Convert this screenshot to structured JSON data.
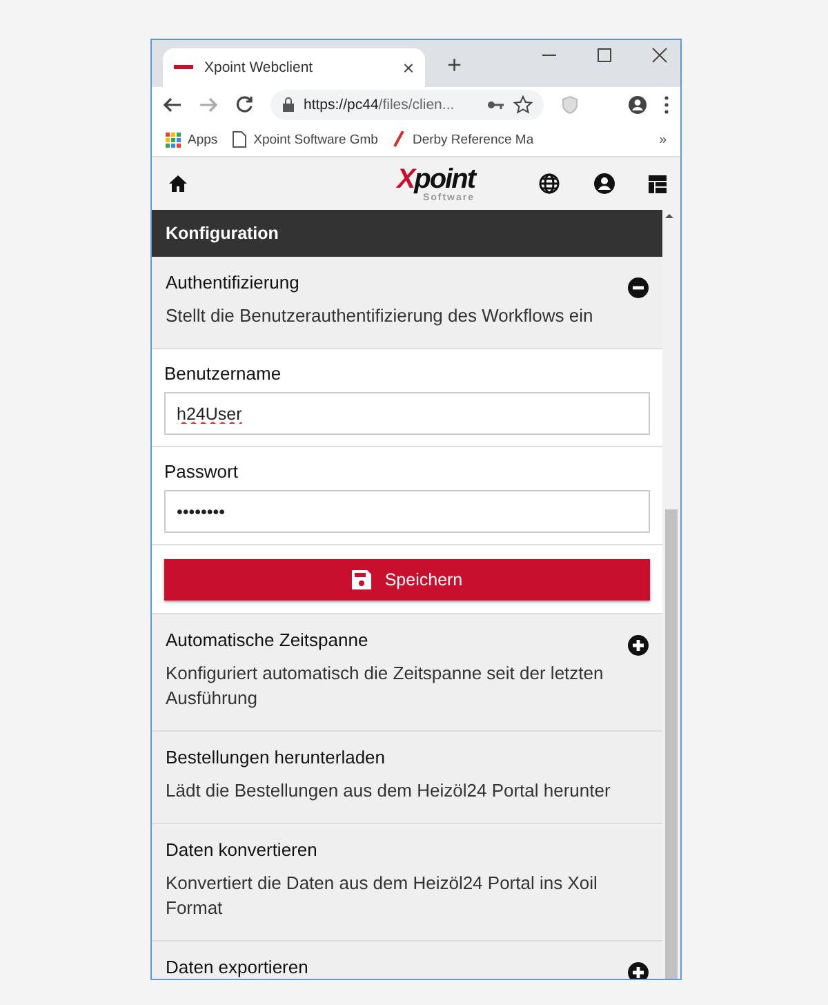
{
  "browser": {
    "tab_title": "Xpoint Webclient",
    "tab_close": "×",
    "new_tab": "+",
    "url_host": "https://pc44",
    "url_path": "/files/clien...",
    "bookmarks": [
      {
        "label": "Apps",
        "kind": "apps"
      },
      {
        "label": "Xpoint Software Gmb",
        "kind": "page"
      },
      {
        "label": "Derby Reference Ma",
        "kind": "pen"
      }
    ],
    "bookmarks_more": "»"
  },
  "app": {
    "logo": "Xpoint",
    "logo_sub": "Software",
    "section_title": "Konfiguration"
  },
  "steps": [
    {
      "title": "Authentifizierung",
      "description": "Stellt die Benutzerauthentifizierung des Workflows ein",
      "kind": "expandable",
      "expanded": true,
      "fields": [
        {
          "label": "Benutzername",
          "value": "h24User",
          "kind": "text"
        },
        {
          "label": "Passwort",
          "value": "••••••••",
          "kind": "password"
        }
      ],
      "save_button": "Speichern"
    },
    {
      "title": "Automatische Zeitspanne",
      "description": "Konfiguriert automatisch die Zeitspanne seit der letzten Ausführung",
      "kind": "expandable",
      "expanded": false
    },
    {
      "title": "Bestellungen herunterladen",
      "description": "Lädt die Bestellungen aus dem Heizöl24 Portal herunter",
      "kind": "plain"
    },
    {
      "title": "Daten konvertieren",
      "description": "Konvertiert die Daten aus dem Heizöl24 Portal ins Xoil Format",
      "kind": "plain"
    },
    {
      "title": "Daten exportieren",
      "kind": "expandable",
      "expanded": false
    }
  ]
}
